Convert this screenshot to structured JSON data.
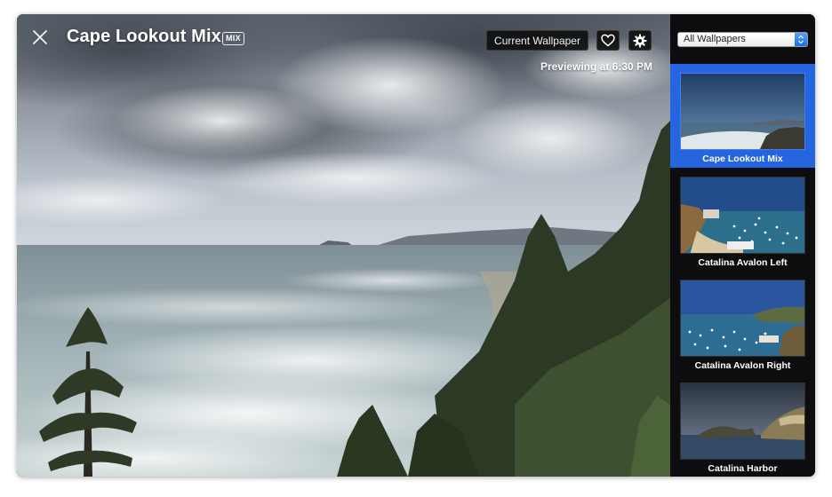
{
  "wallpaper": {
    "title": "Cape Lookout Mix",
    "badge": "MIX",
    "preview_time": "Previewing at 6:30 PM"
  },
  "toolbar": {
    "current_wallpaper_label": "Current Wallpaper",
    "favorite_icon": "heart-icon",
    "settings_icon": "gear-icon",
    "close_icon": "close-icon"
  },
  "sidebar": {
    "filter_value": "All Wallpapers",
    "items": [
      {
        "label": "Cape Lookout Mix",
        "selected": true
      },
      {
        "label": "Catalina Avalon Left",
        "selected": false
      },
      {
        "label": "Catalina Avalon Right",
        "selected": false
      },
      {
        "label": "Catalina Harbor",
        "selected": false
      }
    ]
  },
  "colors": {
    "selection": "#2665e0",
    "sidebar_bg": "#0d0d0f"
  }
}
